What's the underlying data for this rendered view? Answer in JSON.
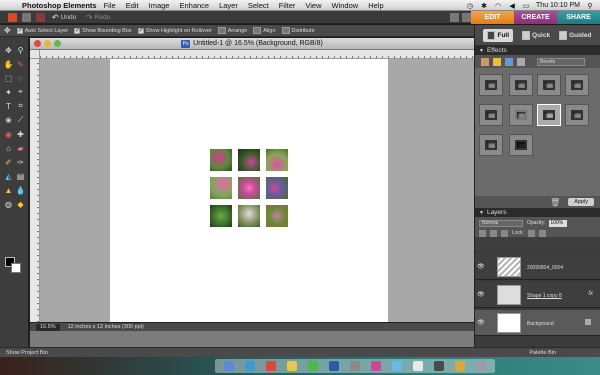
{
  "menubar": {
    "app_name": "Photoshop Elements",
    "items": [
      "File",
      "Edit",
      "Image",
      "Enhance",
      "Layer",
      "Select",
      "Filter",
      "View",
      "Window",
      "Help"
    ],
    "clock": "Thu 10:10 PM"
  },
  "appbar": {
    "undo": "Undo",
    "redo": "Redo"
  },
  "modes": {
    "edit": "EDIT",
    "create": "CREATE",
    "share": "SHARE"
  },
  "options": {
    "auto_select": "Auto Select Layer",
    "show_bounding": "Show Bounding Box",
    "show_highlight": "Show Highlight on Rollover",
    "arrange": "Arrange",
    "align": "Align",
    "distribute": "Distribute"
  },
  "document": {
    "title": "Untitled-1 @ 16.5% (Background, RGB/8)",
    "zoom": "16.5%",
    "doc_size": "12 inches x 12 inches (300 ppi)"
  },
  "panel_tabs": {
    "full": "Full",
    "quick": "Quick",
    "guided": "Guided"
  },
  "effects": {
    "title": "Effects",
    "category": "Bevels",
    "apply": "Apply"
  },
  "layers_panel": {
    "title": "Layers",
    "blend": "Normal",
    "opacity_label": "Opacity:",
    "opacity_value": "100%",
    "lock_label": "Lock:",
    "layers": [
      {
        "name": "20090804_0004"
      },
      {
        "name": "Shape 1 copy 8",
        "fx": "fx"
      },
      {
        "name": "Background"
      }
    ]
  },
  "bottombar": {
    "project_bin": "Show Project Bin",
    "palette_bin": "Palette Bin"
  },
  "colors": {
    "edit": "#e07d12",
    "create": "#8a2f78",
    "share": "#1f7b80"
  }
}
